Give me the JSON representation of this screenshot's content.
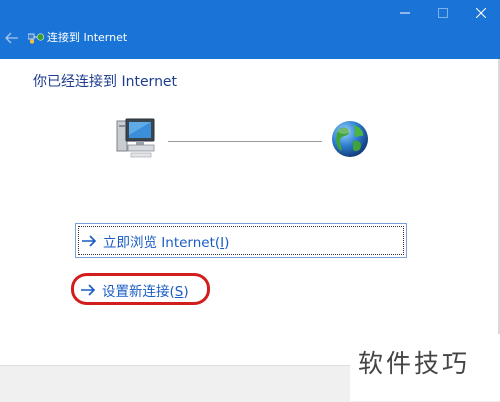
{
  "window": {
    "title": "连接到 Internet",
    "back_icon": "back-arrow-icon",
    "app_icon": "network-connection-icon",
    "controls": [
      "minimize-icon",
      "maximize-icon",
      "close-icon"
    ]
  },
  "main": {
    "heading": "你已经连接到 Internet",
    "pc_icon": "computer-icon",
    "globe_icon": "internet-globe-icon"
  },
  "options": {
    "browse": {
      "text": "立即浏览 Internet(",
      "accel": "I",
      "tail": ")",
      "icon": "arrow-right-icon"
    },
    "new_connection": {
      "text": "设置新连接(",
      "accel": "S",
      "tail": ")",
      "icon": "arrow-right-icon"
    }
  },
  "annotation": {
    "color": "#d21d1d"
  },
  "watermark": {
    "text": "软件技巧"
  },
  "colors": {
    "titlebar": "#1a73d6",
    "heading": "#1e3d8f",
    "link": "#1a5cc4",
    "footer": "#f0f0f0"
  }
}
